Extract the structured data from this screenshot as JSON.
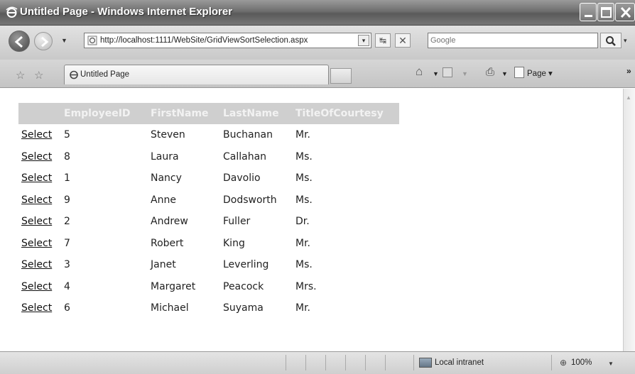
{
  "window": {
    "title": "Untitled Page - Windows Internet Explorer"
  },
  "addressbar": {
    "url": "http://localhost:1111/WebSite/GridViewSortSelection.aspx",
    "search_placeholder": "Google"
  },
  "tabs": [
    {
      "label": "Untitled Page"
    }
  ],
  "commandbar": {
    "page_label": "Page",
    "more_label": "»"
  },
  "grid": {
    "headers": [
      "EmployeeID",
      "FirstName",
      "LastName",
      "TitleOfCourtesy"
    ],
    "select_label": "Select",
    "rows": [
      {
        "id": "5",
        "first": "Steven",
        "last": "Buchanan",
        "title": "Mr."
      },
      {
        "id": "8",
        "first": "Laura",
        "last": "Callahan",
        "title": "Ms."
      },
      {
        "id": "1",
        "first": "Nancy",
        "last": "Davolio",
        "title": "Ms."
      },
      {
        "id": "9",
        "first": "Anne",
        "last": "Dodsworth",
        "title": "Ms."
      },
      {
        "id": "2",
        "first": "Andrew",
        "last": "Fuller",
        "title": "Dr."
      },
      {
        "id": "7",
        "first": "Robert",
        "last": "King",
        "title": "Mr."
      },
      {
        "id": "3",
        "first": "Janet",
        "last": "Leverling",
        "title": "Ms."
      },
      {
        "id": "4",
        "first": "Margaret",
        "last": "Peacock",
        "title": "Mrs."
      },
      {
        "id": "6",
        "first": "Michael",
        "last": "Suyama",
        "title": "Mr."
      }
    ]
  },
  "statusbar": {
    "zone": "Local intranet",
    "zoom": "100%"
  }
}
